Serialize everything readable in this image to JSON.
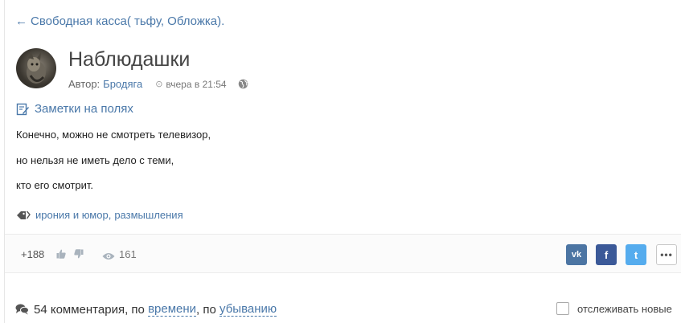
{
  "nav": {
    "back_arrow": "←",
    "back_label": "Свободная касса( тьфу, Обложка)."
  },
  "post": {
    "title": "Наблюдашки",
    "author_label": "Автор:",
    "author": "Бродяга",
    "time": "вчера в 21:54",
    "category": "Заметки на полях",
    "lines": [
      "Конечно, можно не смотреть телевизор,",
      "но нельзя не иметь дело с теми,",
      "кто его смотрит."
    ],
    "tags": [
      "ирония и юмор",
      "размышления"
    ],
    "tag_separator": ","
  },
  "stats": {
    "rating": "+188",
    "views": "161"
  },
  "share": {
    "vk": "vk",
    "fb": "f",
    "tw": "t",
    "more": "•••"
  },
  "comments": {
    "count_label": "54 комментария",
    "sort_by": "по времени",
    "order": "по убыванию",
    "sep": ",",
    "follow_label": "отслеживать новые"
  },
  "icons": {
    "time": "clock-icon",
    "globe": "globe-icon",
    "category": "note-edit-icon",
    "tag": "tags-icon",
    "like": "thumbs-up-icon",
    "dislike": "thumbs-down-icon",
    "views": "eye-icon",
    "comments": "comments-icon"
  },
  "colors": {
    "link": "#4a78a9",
    "vk": "#4c75a3",
    "fb": "#3b5998",
    "tw": "#55acee"
  }
}
